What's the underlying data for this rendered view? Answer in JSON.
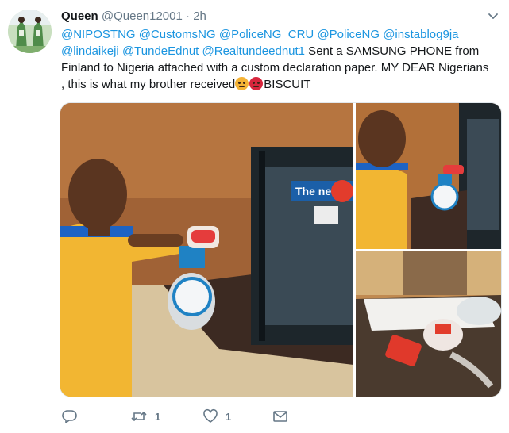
{
  "tweet": {
    "display_name": "Queen",
    "handle": "@Queen12001",
    "separator": "·",
    "time": "2h",
    "mentions": [
      "@NIPOSTNG",
      "@CustomsNG",
      "@PoliceNG_CRU",
      "@PoliceNG",
      "@instablog9ja",
      "@lindaikeji",
      "@TundeEdnut",
      "@Realtundeednut1"
    ],
    "body_line1_rest": " Sent a SAMSUNG PHONE from",
    "body_line2": "Finland to Nigeria attached with a custom declaration paper. MY DEAR  Nigerians",
    "body_line3_start": ", this is what my brother received",
    "body_line3_end": "BISCUIT",
    "emojis": [
      "angry-face",
      "pouting-face"
    ]
  },
  "media": {
    "photos": [
      {
        "subject": "man in yellow shirt weighing a package on a scale at a counter window"
      },
      {
        "subject": "man beside scale at counter window"
      },
      {
        "subject": "opened package with biscuits on a counter"
      }
    ],
    "window_sign_text": "The ne"
  },
  "actions": {
    "reply_count": "",
    "retweet_count": "1",
    "like_count": "1"
  },
  "colors": {
    "link": "#1b95e0",
    "secondary": "#657786",
    "border": "#e1e8ed"
  }
}
